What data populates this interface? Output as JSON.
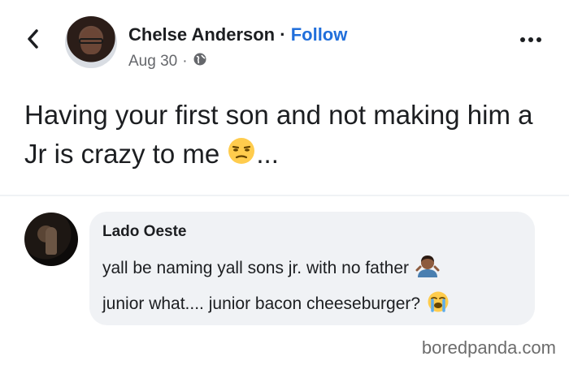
{
  "post": {
    "author": "Chelse Anderson",
    "separator": "·",
    "follow_label": "Follow",
    "date": "Aug 30",
    "date_separator": "·",
    "text": "Having your first son and not making him a Jr is crazy to me",
    "text_suffix": "...",
    "icons": {
      "back": "chevron-left-icon",
      "privacy": "globe-icon",
      "more": "more-options-icon",
      "text_emoji": "unamused-face-emoji"
    }
  },
  "comment": {
    "author": "Lado Oeste",
    "line1": "yall be naming yall sons jr. with no father",
    "line2": "junior what.... junior bacon cheeseburger?",
    "icons": {
      "line1_emoji": "man-shrugging-emoji",
      "line2_emoji": "loudly-crying-face-emoji"
    }
  },
  "watermark": "boredpanda.com",
  "colors": {
    "link": "#216fdb",
    "meta": "#65676b",
    "bubble": "#f0f2f5",
    "text": "#1c1e21"
  }
}
